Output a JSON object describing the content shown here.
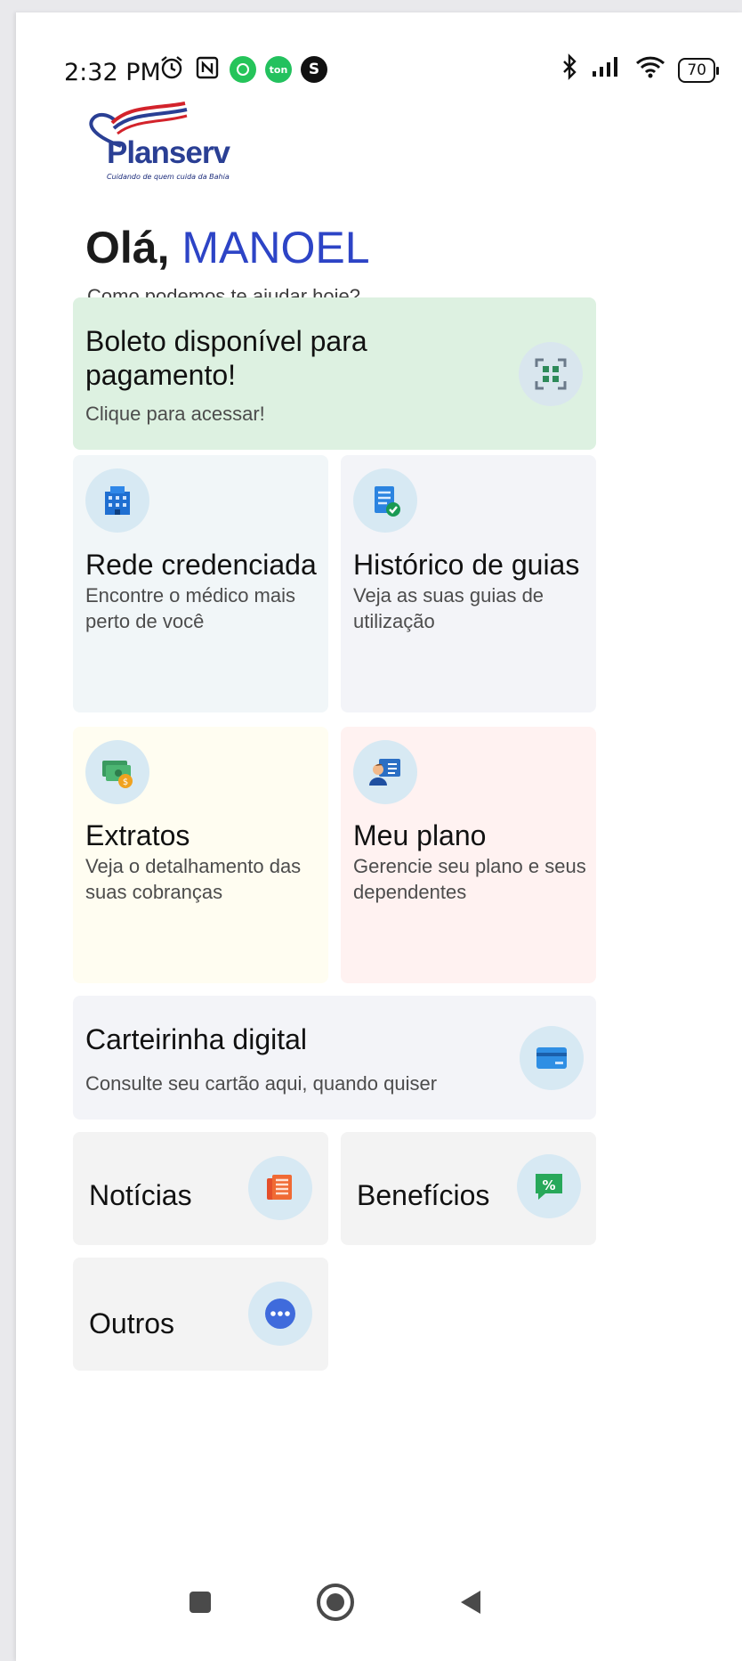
{
  "status_bar": {
    "time": "2:32 PM",
    "battery": "70",
    "icons": [
      "alarm-icon",
      "nfc-icon",
      "whatsapp-icon",
      "ton-icon",
      "s-app-icon",
      "bluetooth-icon",
      "signal-icon",
      "wifi-icon"
    ]
  },
  "logo": {
    "word": "Planserv",
    "tagline": "Cuidando de quem cuida da Bahia"
  },
  "greeting": {
    "hello": "Olá, ",
    "name": "MANOEL",
    "subtitle": "Como podemos te ajudar hoje?"
  },
  "boleto": {
    "title": "Boleto disponível para pagamento!",
    "subtitle": "Clique para acessar!",
    "icon": "qr-scan-icon"
  },
  "cards": {
    "rede": {
      "title": "Rede credenciada",
      "desc": "Encontre o médico mais perto de você",
      "icon": "building-icon"
    },
    "historico": {
      "title": "Histórico de guias",
      "desc": "Veja as suas guias de utilização",
      "icon": "document-check-icon"
    },
    "extratos": {
      "title": "Extratos",
      "desc": "Veja o detalhamento das suas cobranças",
      "icon": "money-icon"
    },
    "meu_plano": {
      "title": "Meu plano",
      "desc": "Gerencie seu plano e seus dependentes",
      "icon": "person-card-icon"
    }
  },
  "carteirinha": {
    "title": "Carteirinha digital",
    "subtitle": "Consulte seu cartão aqui, quando quiser",
    "icon": "credit-card-icon"
  },
  "small_cards": {
    "noticias": {
      "title": "Notícias",
      "icon": "newspaper-icon"
    },
    "beneficios": {
      "title": "Benefícios",
      "icon": "percent-tag-icon"
    },
    "outros": {
      "title": "Outros",
      "icon": "more-dots-icon"
    }
  },
  "colors": {
    "accent": "#2d44c6",
    "boleto_bg": "#ddf1e1",
    "rede_bg": "#f1f6f8",
    "historico_bg": "#f3f4f8",
    "extratos_bg": "#fffdf1",
    "meu_plano_bg": "#fff2f1",
    "neutral_bg": "#f3f3f3"
  }
}
